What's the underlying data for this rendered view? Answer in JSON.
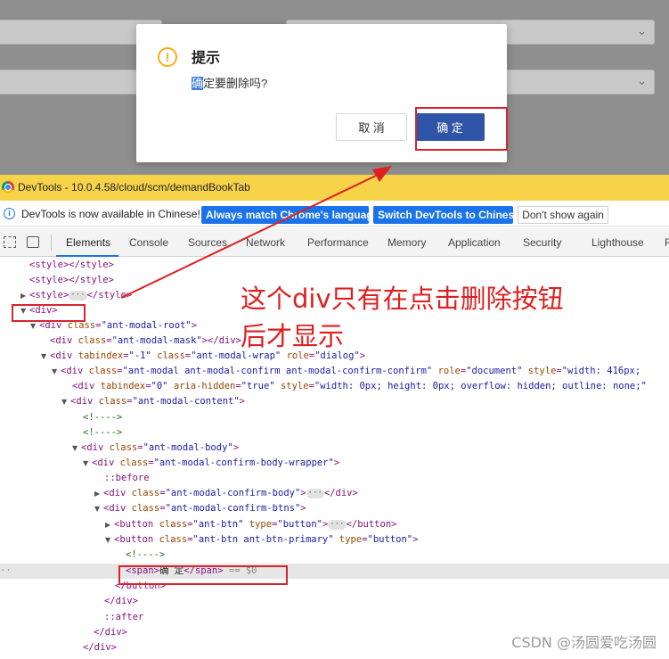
{
  "dialog": {
    "title": "提示",
    "message_highlight": "确",
    "message_rest": "定要删除吗?",
    "cancel_label": "取 消",
    "ok_label": "确 定",
    "warn_glyph": "!",
    "warn_color": "#faad14",
    "primary_color": "#2f55a8"
  },
  "devtools": {
    "window_title": "DevTools - 10.0.4.58/cloud/scm/demandBookTab",
    "infobar": {
      "message": "DevTools is now available in Chinese!",
      "match_language_label": "Always match Chrome's language",
      "switch_label": "Switch DevTools to Chinese",
      "dismiss_label": "Don't show again"
    },
    "tabs": [
      "Elements",
      "Console",
      "Sources",
      "Network",
      "Performance",
      "Memory",
      "Application",
      "Security",
      "Lighthouse",
      "R"
    ],
    "active_tab": "Elements",
    "dom": {
      "style_tag": "style",
      "div_tag": "div",
      "button_tag": "button",
      "span_tag": "span",
      "attr_class": "class",
      "attr_tabindex": "tabindex",
      "attr_role": "role",
      "attr_style": "style",
      "attr_aria_hidden": "aria-hidden",
      "attr_type": "type",
      "val_modal_root": "\"ant-modal-root\"",
      "val_modal_mask": "\"ant-modal-mask\"",
      "val_tabindex_neg": "\"-1\"",
      "val_modal_wrap": "\"ant-modal-wrap\"",
      "val_role_dialog": "\"dialog\"",
      "val_modal_confirm": "\"ant-modal ant-modal-confirm ant-modal-confirm-confirm\"",
      "val_role_document": "\"document\"",
      "val_width_416": "\"width: 416px;",
      "val_tabindex_zero": "\"0\"",
      "val_true": "\"true\"",
      "val_sentinel_style": "\"width: 0px; height: 0px; overflow: hidden; outline: none;\"",
      "val_modal_content": "\"ant-modal-content\"",
      "val_modal_body": "\"ant-modal-body\"",
      "val_body_wrapper": "\"ant-modal-confirm-body-wrapper\"",
      "val_confirm_body": "\"ant-modal-confirm-body\"",
      "val_confirm_btns": "\"ant-modal-confirm-btns\"",
      "val_ant_btn": "\"ant-btn\"",
      "val_button": "\"button\"",
      "val_btn_primary": "\"ant-btn ant-btn-primary\"",
      "comment": "<!---->",
      "before": "::before",
      "after": "::after",
      "span_text": "确 定",
      "dollar_ref": "== $0"
    }
  },
  "annotation": {
    "line1": "这个div只有在点击删除按钮",
    "line2": "后才显示",
    "color": "#e01f1f"
  },
  "watermark": "CSDN @汤圆爱吃汤圆"
}
